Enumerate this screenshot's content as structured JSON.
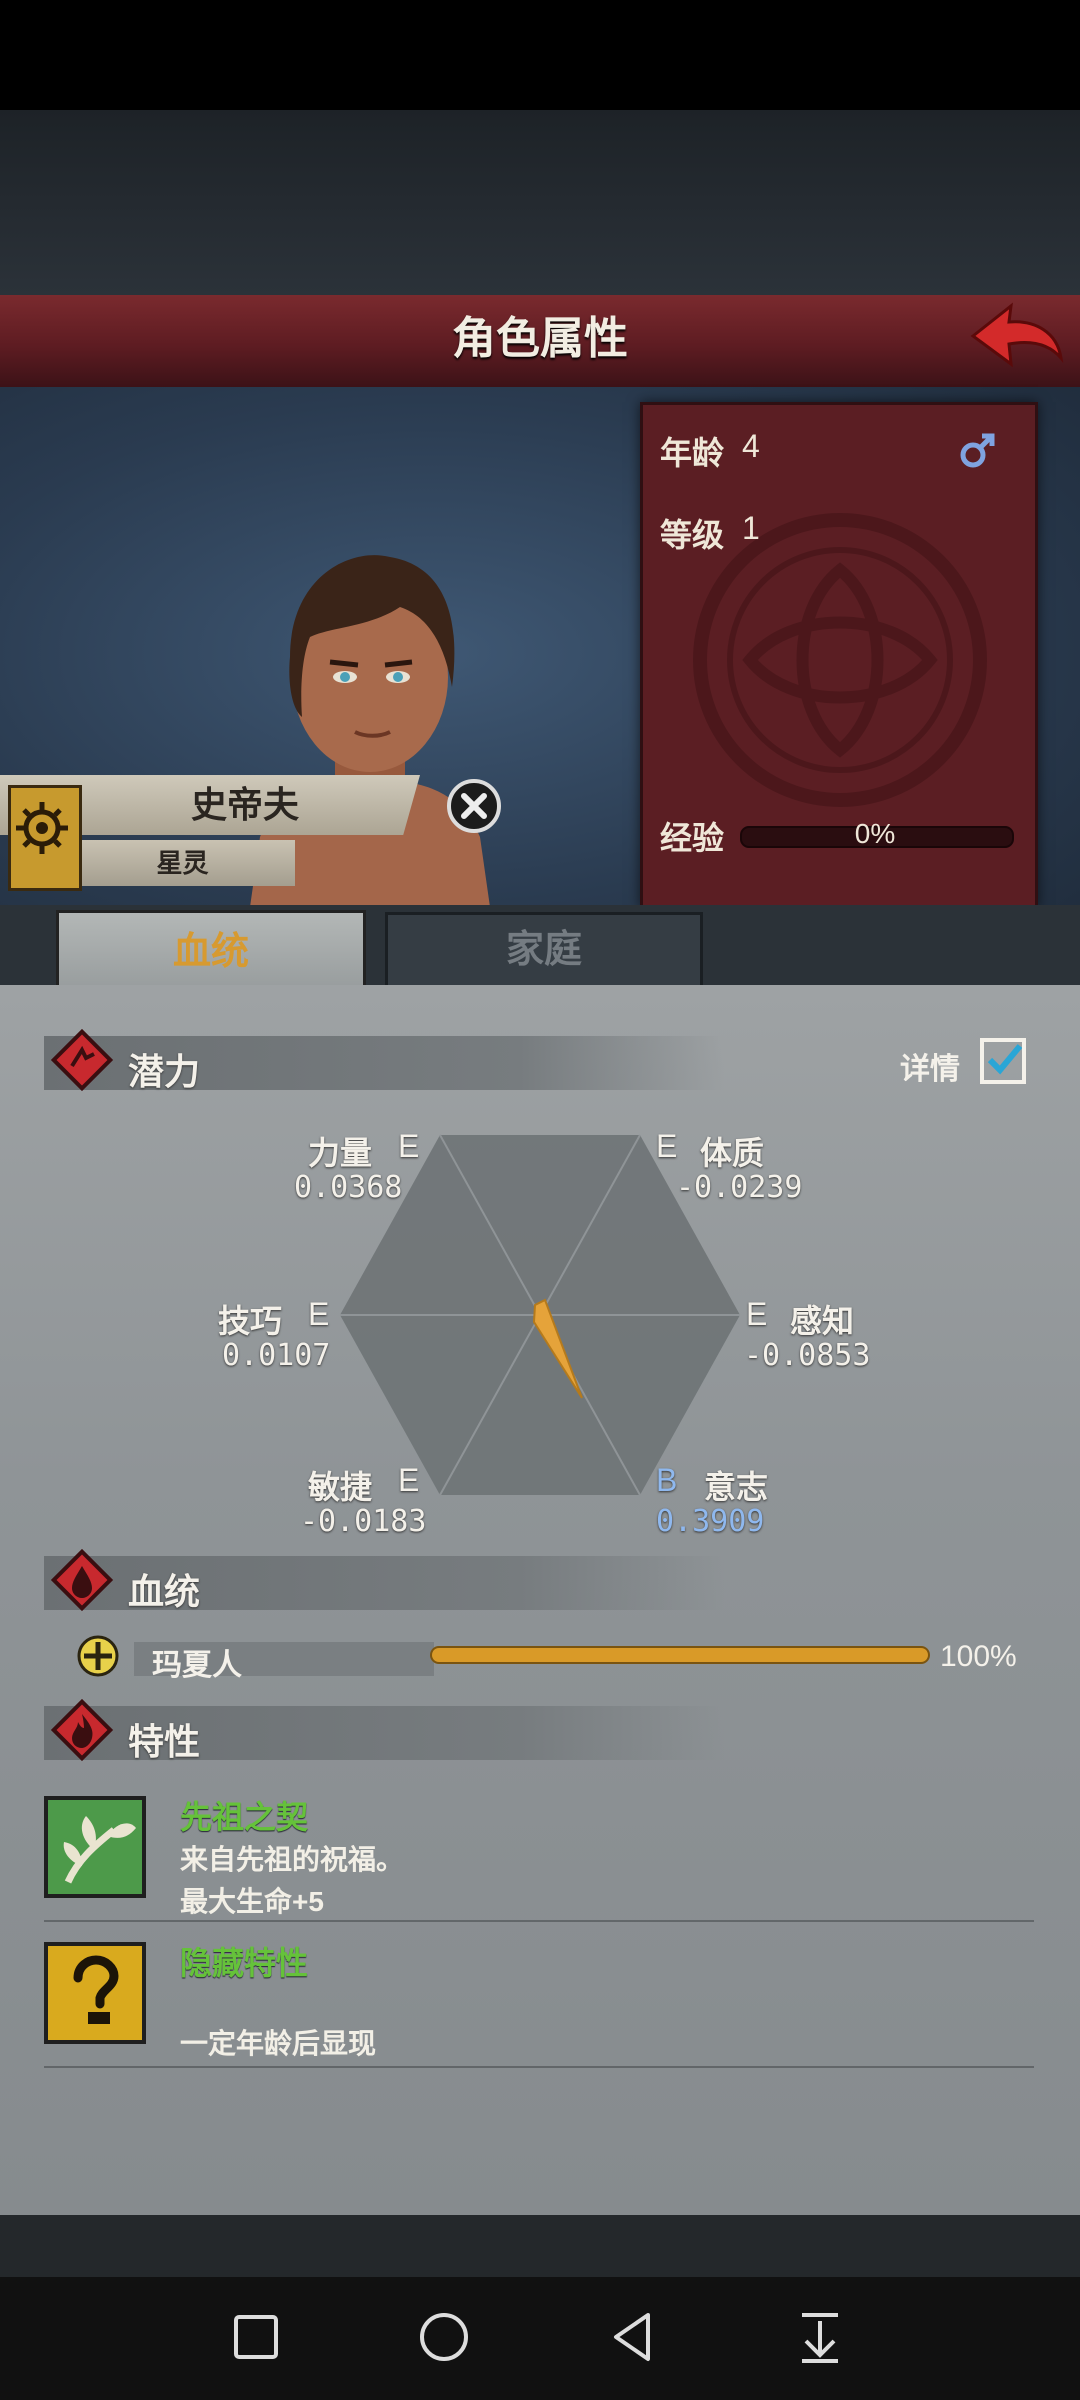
{
  "header": {
    "title": "角色属性",
    "back_icon": "back-arrow-icon"
  },
  "character": {
    "name": "史帝夫",
    "subtitle": "星灵",
    "gender_icon": "male-icon"
  },
  "stats": {
    "age_label": "年龄",
    "age_value": "4",
    "level_label": "等级",
    "level_value": "1",
    "exp_label": "经验",
    "exp_value": "0%"
  },
  "tabs": [
    {
      "label": "血统",
      "active": true
    },
    {
      "label": "家庭",
      "active": false
    }
  ],
  "potential": {
    "title": "潜力",
    "detail_label": "详情",
    "attributes": [
      {
        "name": "力量",
        "grade": "E",
        "value": "0.0368"
      },
      {
        "name": "体质",
        "grade": "E",
        "value": "-0.0239"
      },
      {
        "name": "技巧",
        "grade": "E",
        "value": "0.0107"
      },
      {
        "name": "感知",
        "grade": "E",
        "value": "-0.0853"
      },
      {
        "name": "敏捷",
        "grade": "E",
        "value": "-0.0183"
      },
      {
        "name": "意志",
        "grade": "B",
        "value": "0.3909"
      }
    ]
  },
  "bloodline": {
    "title": "血统",
    "items": [
      {
        "name": "玛夏人",
        "percent": "100%",
        "fill": 1.0
      }
    ]
  },
  "traits": {
    "title": "特性",
    "items": [
      {
        "name": "先祖之契",
        "desc1": "来自先祖的祝福。",
        "desc2": "最大生命+5"
      },
      {
        "name": "隐藏特性",
        "desc1": "",
        "desc2": "一定年龄后显现"
      }
    ]
  },
  "colors": {
    "header": "#6a2328",
    "panel": "#5b1e23",
    "content": "#8f9497",
    "trait_name": "#65c23a",
    "grade_high": "#8fb8ee",
    "bloodline_bar": "#d99a28"
  },
  "navbar": [
    "square-nav-icon",
    "circle-home-icon",
    "triangle-back-icon",
    "down-arrow-icon"
  ]
}
